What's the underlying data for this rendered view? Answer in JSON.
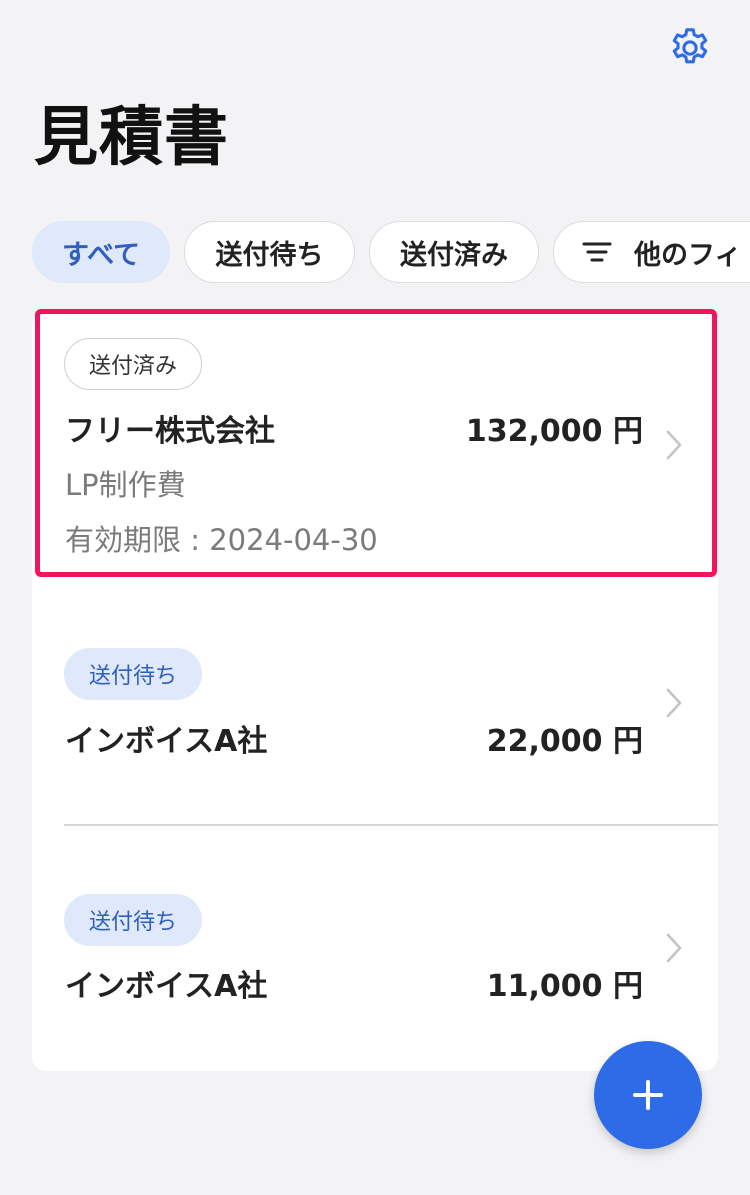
{
  "header": {
    "title": "見積書",
    "settings_icon": "gear-icon"
  },
  "filters": {
    "all": "すべて",
    "pending": "送付待ち",
    "sent": "送付済み",
    "more": "他のフィ",
    "more_icon": "filter-lines-icon",
    "selected": "すべて"
  },
  "quotes": [
    {
      "status": "送付済み",
      "client": "フリー株式会社",
      "amount": "132,000 円",
      "subject": "LP制作費",
      "expiry": "有効期限 : 2024-04-30"
    },
    {
      "status": "送付待ち",
      "client": "インボイスA社",
      "amount": "22,000 円"
    },
    {
      "status": "送付待ち",
      "client": "インボイスA社",
      "amount": "11,000 円"
    }
  ],
  "fab": {
    "icon": "plus-icon"
  },
  "colors": {
    "accent": "#2e6be6",
    "highlight": "#f0165b",
    "active_chip_bg": "#dfe9fb",
    "active_chip_text": "#2f5fbf",
    "background": "#f3f2f4"
  }
}
